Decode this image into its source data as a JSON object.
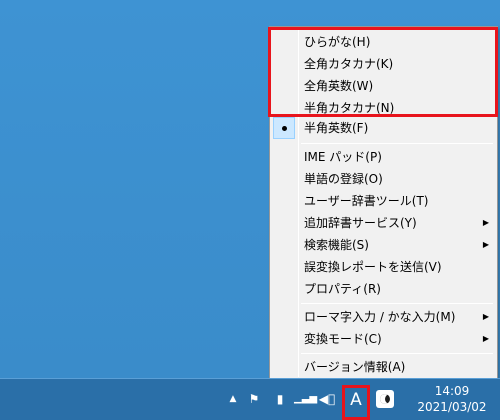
{
  "menu": {
    "items": [
      {
        "label": "ひらがな(H)"
      },
      {
        "label": "全角カタカナ(K)"
      },
      {
        "label": "全角英数(W)"
      },
      {
        "label": "半角カタカナ(N)"
      },
      {
        "label": "半角英数(F)",
        "checked": true
      },
      {
        "label": "IME パッド(P)"
      },
      {
        "label": "単語の登録(O)"
      },
      {
        "label": "ユーザー辞書ツール(T)"
      },
      {
        "label": "追加辞書サービス(Y)",
        "submenu": true
      },
      {
        "label": "検索機能(S)",
        "submenu": true
      },
      {
        "label": "誤変換レポートを送信(V)"
      },
      {
        "label": "プロパティ(R)"
      },
      {
        "label": "ローマ字入力 / かな入力(M)",
        "submenu": true
      },
      {
        "label": "変換モード(C)",
        "submenu": true
      },
      {
        "label": "バージョン情報(A)"
      }
    ],
    "submenu_arrow": "▶"
  },
  "taskbar": {
    "ime_mode_label": "A",
    "clock_time": "14:09",
    "clock_date": "2021/03/02",
    "tray_icons": [
      "up-arrow-icon",
      "flag-icon",
      "battery-icon",
      "signal-icon",
      "speaker-muted-icon",
      "ime-mode-icon",
      "night-mode-icon"
    ]
  },
  "colors": {
    "desktop": "#3b8fcf",
    "taskbar": "#2a6fa8",
    "highlight": "#e8141c",
    "menu_bg": "#f1f1f1",
    "selected_bg": "#cce8ff"
  }
}
